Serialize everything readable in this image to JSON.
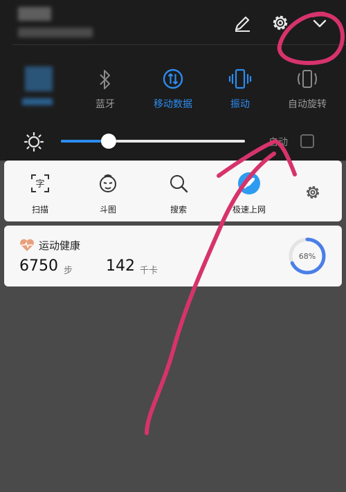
{
  "header": {
    "edit_icon": "pencil-icon",
    "settings_icon": "gear-icon",
    "collapse_icon": "chevron-down-icon"
  },
  "quick_settings": [
    {
      "label": "蓝牙",
      "icon": "bluetooth-icon",
      "active": false
    },
    {
      "label": "移动数据",
      "icon": "mobile-data-icon",
      "active": true
    },
    {
      "label": "振动",
      "icon": "vibrate-icon",
      "active": true
    },
    {
      "label": "自动旋转",
      "icon": "auto-rotate-icon",
      "active": false
    }
  ],
  "brightness": {
    "level": 0.26,
    "auto_label": "自动",
    "auto_checked": false
  },
  "tools": [
    {
      "label": "扫描",
      "icon": "scan-icon"
    },
    {
      "label": "斗图",
      "icon": "meme-face-icon"
    },
    {
      "label": "搜索",
      "icon": "search-icon"
    },
    {
      "label": "极速上网",
      "icon": "rocket-icon"
    }
  ],
  "health": {
    "title": "运动健康",
    "steps": "6750",
    "steps_unit": "步",
    "calories": "142",
    "calories_unit": "千卡",
    "progress_label": "68%",
    "progress": 0.68
  },
  "colors": {
    "accent": "#2d8cf0",
    "annotation": "#d6336c",
    "shade": "#1c1c1c",
    "background": "#4a4a4a"
  }
}
